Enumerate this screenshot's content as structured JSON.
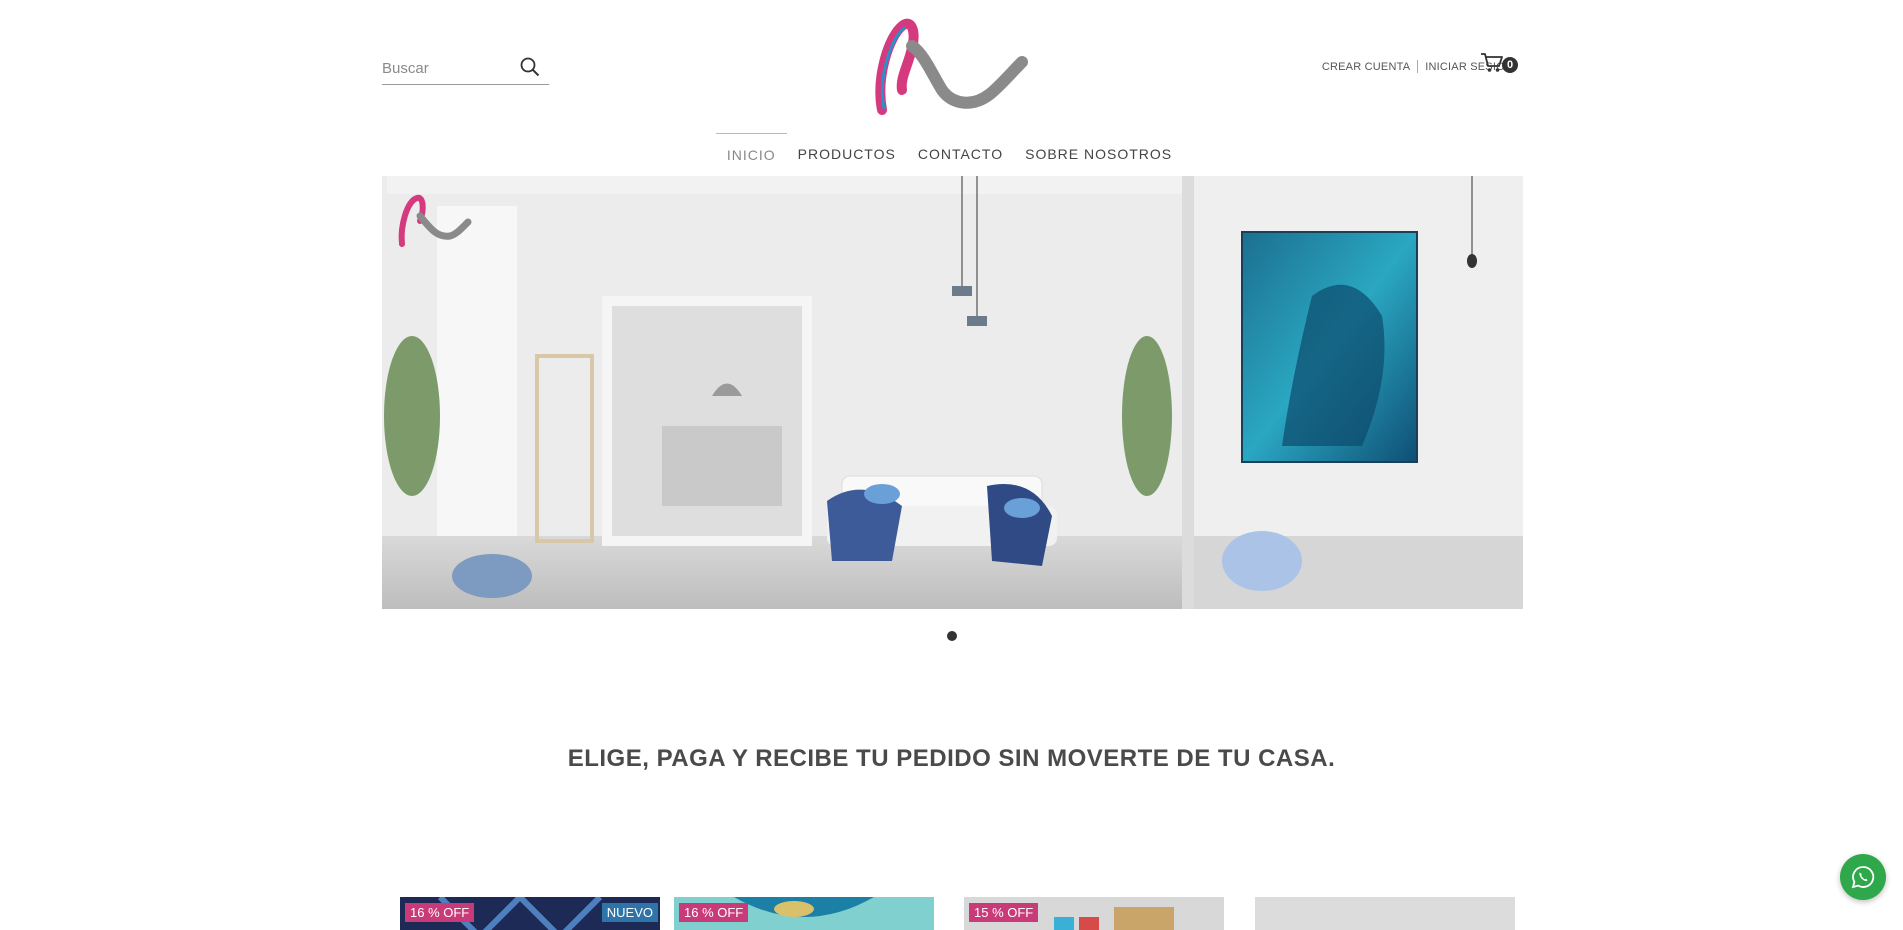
{
  "header": {
    "search_placeholder": "Buscar",
    "account": {
      "create_label": "CREAR CUENTA",
      "login_label": "INICIAR SESIÓN"
    },
    "cart_count": "0"
  },
  "nav": {
    "items": [
      {
        "label": "INICIO",
        "active": true
      },
      {
        "label": "PRODUCTOS"
      },
      {
        "label": "CONTACTO"
      },
      {
        "label": "SOBRE NOSOTROS"
      }
    ]
  },
  "hero": {
    "slide_count": 1,
    "active_slide": 1
  },
  "headline": "ELIGE, PAGA Y RECIBE TU PEDIDO SIN MOVERTE DE TU CASA.",
  "products": [
    {
      "discount": "16 % OFF",
      "badge": "NUEVO"
    },
    {
      "discount": "16 % OFF"
    },
    {
      "discount": "15 % OFF"
    },
    {}
  ],
  "colors": {
    "brand_pink": "#d63a7e",
    "brand_grey": "#8a8a8a",
    "discount_tag": "#c93a78",
    "new_tag": "#2f74a8",
    "whatsapp": "#2ea84a"
  },
  "icons": [
    "search-icon",
    "cart-icon",
    "whatsapp-icon"
  ]
}
